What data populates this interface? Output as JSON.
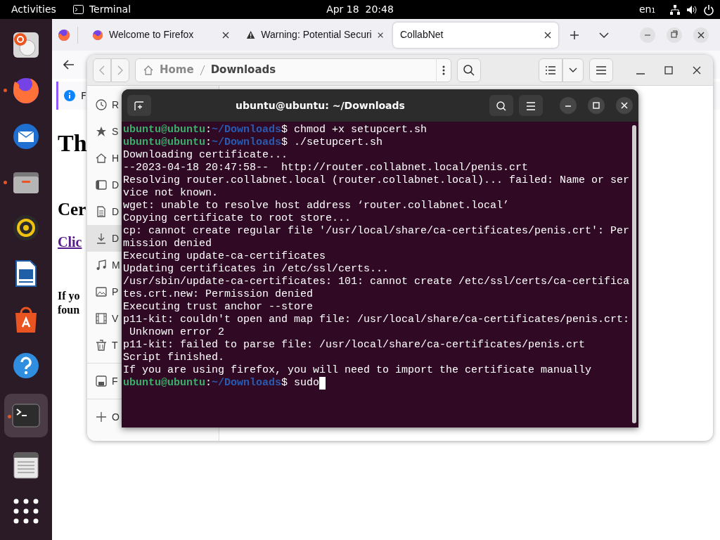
{
  "top_bar": {
    "activities": "Activities",
    "app_name": "Terminal",
    "clock": "Apr 18  20:48",
    "input_source": "en₁"
  },
  "dock": [
    {
      "kind": "installer",
      "running": false,
      "selected": false
    },
    {
      "kind": "browser",
      "running": true,
      "selected": false
    },
    {
      "kind": "mail",
      "running": false,
      "selected": false
    },
    {
      "kind": "files",
      "running": true,
      "selected": false
    },
    {
      "kind": "music",
      "running": false,
      "selected": false
    },
    {
      "kind": "writer",
      "running": false,
      "selected": false
    },
    {
      "kind": "software",
      "running": false,
      "selected": false
    },
    {
      "kind": "help",
      "running": false,
      "selected": false
    },
    {
      "kind": "terminal",
      "running": true,
      "selected": true
    },
    {
      "kind": "editor",
      "running": false,
      "selected": false
    },
    {
      "kind": "grid",
      "running": false,
      "selected": false
    }
  ],
  "browser": {
    "tabs": [
      {
        "label": "Welcome to Firefox",
        "kind": "firefox",
        "selected": false
      },
      {
        "label": "Warning: Potential Securi",
        "kind": "warning",
        "selected": false
      },
      {
        "label": "CollabNet",
        "kind": "plain",
        "selected": true
      }
    ],
    "notification": "F",
    "page": {
      "heading": "Th",
      "subheading": "Cer",
      "link": "Clic",
      "paragraph": [
        "If yo",
        "foun"
      ]
    }
  },
  "files": {
    "path": [
      {
        "label": "Home",
        "kind": "home"
      },
      {
        "label": "Downloads",
        "kind": "current"
      }
    ],
    "sidebar": [
      {
        "label": "R",
        "kind": "recent",
        "selected": false
      },
      {
        "label": "S",
        "kind": "starred",
        "selected": false
      },
      {
        "label": "H",
        "kind": "home",
        "selected": false
      },
      {
        "label": "D",
        "kind": "desktop",
        "selected": false
      },
      {
        "label": "D",
        "kind": "documents",
        "selected": false
      },
      {
        "label": "D",
        "kind": "downloads",
        "selected": true
      },
      {
        "label": "M",
        "kind": "music",
        "selected": false
      },
      {
        "label": "P",
        "kind": "pictures",
        "selected": false
      },
      {
        "label": "V",
        "kind": "videos",
        "selected": false
      },
      {
        "label": "T",
        "kind": "trash",
        "selected": false
      },
      {
        "label": "F",
        "kind": "drive",
        "selected": false
      },
      {
        "label": "O",
        "kind": "other",
        "selected": false
      }
    ]
  },
  "terminal": {
    "title": "ubuntu@ubuntu: ~/Downloads",
    "lines": [
      {
        "kind": "prompt",
        "user": "ubuntu@ubuntu",
        "sep": ":",
        "path": "~/Downloads",
        "text": "$ chmod +x setupcert.sh",
        "cursor": false
      },
      {
        "kind": "prompt",
        "user": "ubuntu@ubuntu",
        "sep": ":",
        "path": "~/Downloads",
        "text": "$ ./setupcert.sh",
        "cursor": false
      },
      {
        "kind": "output",
        "text": "Downloading certificate..."
      },
      {
        "kind": "output",
        "text": "--2023-04-18 20:47:58--  http://router.collabnet.local/penis.crt"
      },
      {
        "kind": "output",
        "text": "Resolving router.collabnet.local (router.collabnet.local)... failed: Name or ser"
      },
      {
        "kind": "output",
        "text": "vice not known."
      },
      {
        "kind": "output",
        "text": "wget: unable to resolve host address ‘router.collabnet.local’"
      },
      {
        "kind": "output",
        "text": "Copying certificate to root store..."
      },
      {
        "kind": "output",
        "text": "cp: cannot create regular file '/usr/local/share/ca-certificates/penis.crt': Per"
      },
      {
        "kind": "output",
        "text": "mission denied"
      },
      {
        "kind": "output",
        "text": "Executing update-ca-certificates"
      },
      {
        "kind": "output",
        "text": "Updating certificates in /etc/ssl/certs..."
      },
      {
        "kind": "output",
        "text": "/usr/sbin/update-ca-certificates: 101: cannot create /etc/ssl/certs/ca-certifica"
      },
      {
        "kind": "output",
        "text": "tes.crt.new: Permission denied"
      },
      {
        "kind": "output",
        "text": "Executing trust anchor --store"
      },
      {
        "kind": "output",
        "text": "p11-kit: couldn't open and map file: /usr/local/share/ca-certificates/penis.crt:"
      },
      {
        "kind": "output",
        "text": " Unknown error 2"
      },
      {
        "kind": "output",
        "text": "p11-kit: failed to parse file: /usr/local/share/ca-certificates/penis.crt"
      },
      {
        "kind": "output",
        "text": "Script finished."
      },
      {
        "kind": "output",
        "text": "If you are using firefox, you will need to import the certificate manually"
      },
      {
        "kind": "prompt",
        "user": "ubuntu@ubuntu",
        "sep": ":",
        "path": "~/Downloads",
        "text": "$ sudo",
        "cursor": true
      }
    ]
  }
}
